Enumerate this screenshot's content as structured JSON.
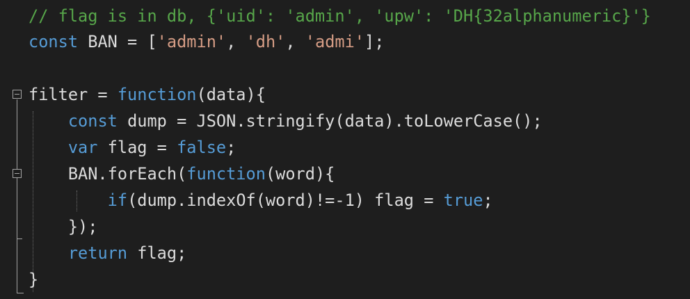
{
  "editor": {
    "lines": [
      {
        "segments": [
          {
            "text": "// flag is in db, {'uid': 'admin', 'upw': 'DH{32alphanumeric}'}",
            "kind": "comment"
          }
        ]
      },
      {
        "segments": [
          {
            "text": "const",
            "kind": "keyword"
          },
          {
            "text": " BAN = [",
            "kind": "plain"
          },
          {
            "text": "'admin'",
            "kind": "string"
          },
          {
            "text": ", ",
            "kind": "plain"
          },
          {
            "text": "'dh'",
            "kind": "string"
          },
          {
            "text": ", ",
            "kind": "plain"
          },
          {
            "text": "'admi'",
            "kind": "string"
          },
          {
            "text": "];",
            "kind": "plain"
          }
        ]
      },
      {
        "segments": []
      },
      {
        "segments": [
          {
            "text": "filter = ",
            "kind": "plain"
          },
          {
            "text": "function",
            "kind": "keyword"
          },
          {
            "text": "(data){",
            "kind": "plain"
          }
        ]
      },
      {
        "segments": [
          {
            "text": "    ",
            "kind": "plain"
          },
          {
            "text": "const",
            "kind": "keyword"
          },
          {
            "text": " dump = JSON.stringify(data).toLowerCase();",
            "kind": "plain"
          }
        ]
      },
      {
        "segments": [
          {
            "text": "    ",
            "kind": "plain"
          },
          {
            "text": "var",
            "kind": "keyword"
          },
          {
            "text": " flag = ",
            "kind": "plain"
          },
          {
            "text": "false",
            "kind": "keyword"
          },
          {
            "text": ";",
            "kind": "plain"
          }
        ]
      },
      {
        "segments": [
          {
            "text": "    BAN.forEach(",
            "kind": "plain"
          },
          {
            "text": "function",
            "kind": "keyword"
          },
          {
            "text": "(word){",
            "kind": "plain"
          }
        ]
      },
      {
        "segments": [
          {
            "text": "        ",
            "kind": "plain"
          },
          {
            "text": "if",
            "kind": "keyword"
          },
          {
            "text": "(dump.indexOf(word)!=-1) flag = ",
            "kind": "plain"
          },
          {
            "text": "true",
            "kind": "keyword"
          },
          {
            "text": ";",
            "kind": "plain"
          }
        ]
      },
      {
        "segments": [
          {
            "text": "    });",
            "kind": "plain"
          }
        ]
      },
      {
        "segments": [
          {
            "text": "    ",
            "kind": "plain"
          },
          {
            "text": "return",
            "kind": "keyword"
          },
          {
            "text": " flag;",
            "kind": "plain"
          }
        ]
      },
      {
        "segments": [
          {
            "text": "}",
            "kind": "plain"
          }
        ]
      }
    ],
    "colors": {
      "background": "#1e1e1e",
      "keyword": "#569cd6",
      "string": "#d69d85",
      "comment": "#57a64a",
      "plain": "#dcdcdc"
    }
  }
}
